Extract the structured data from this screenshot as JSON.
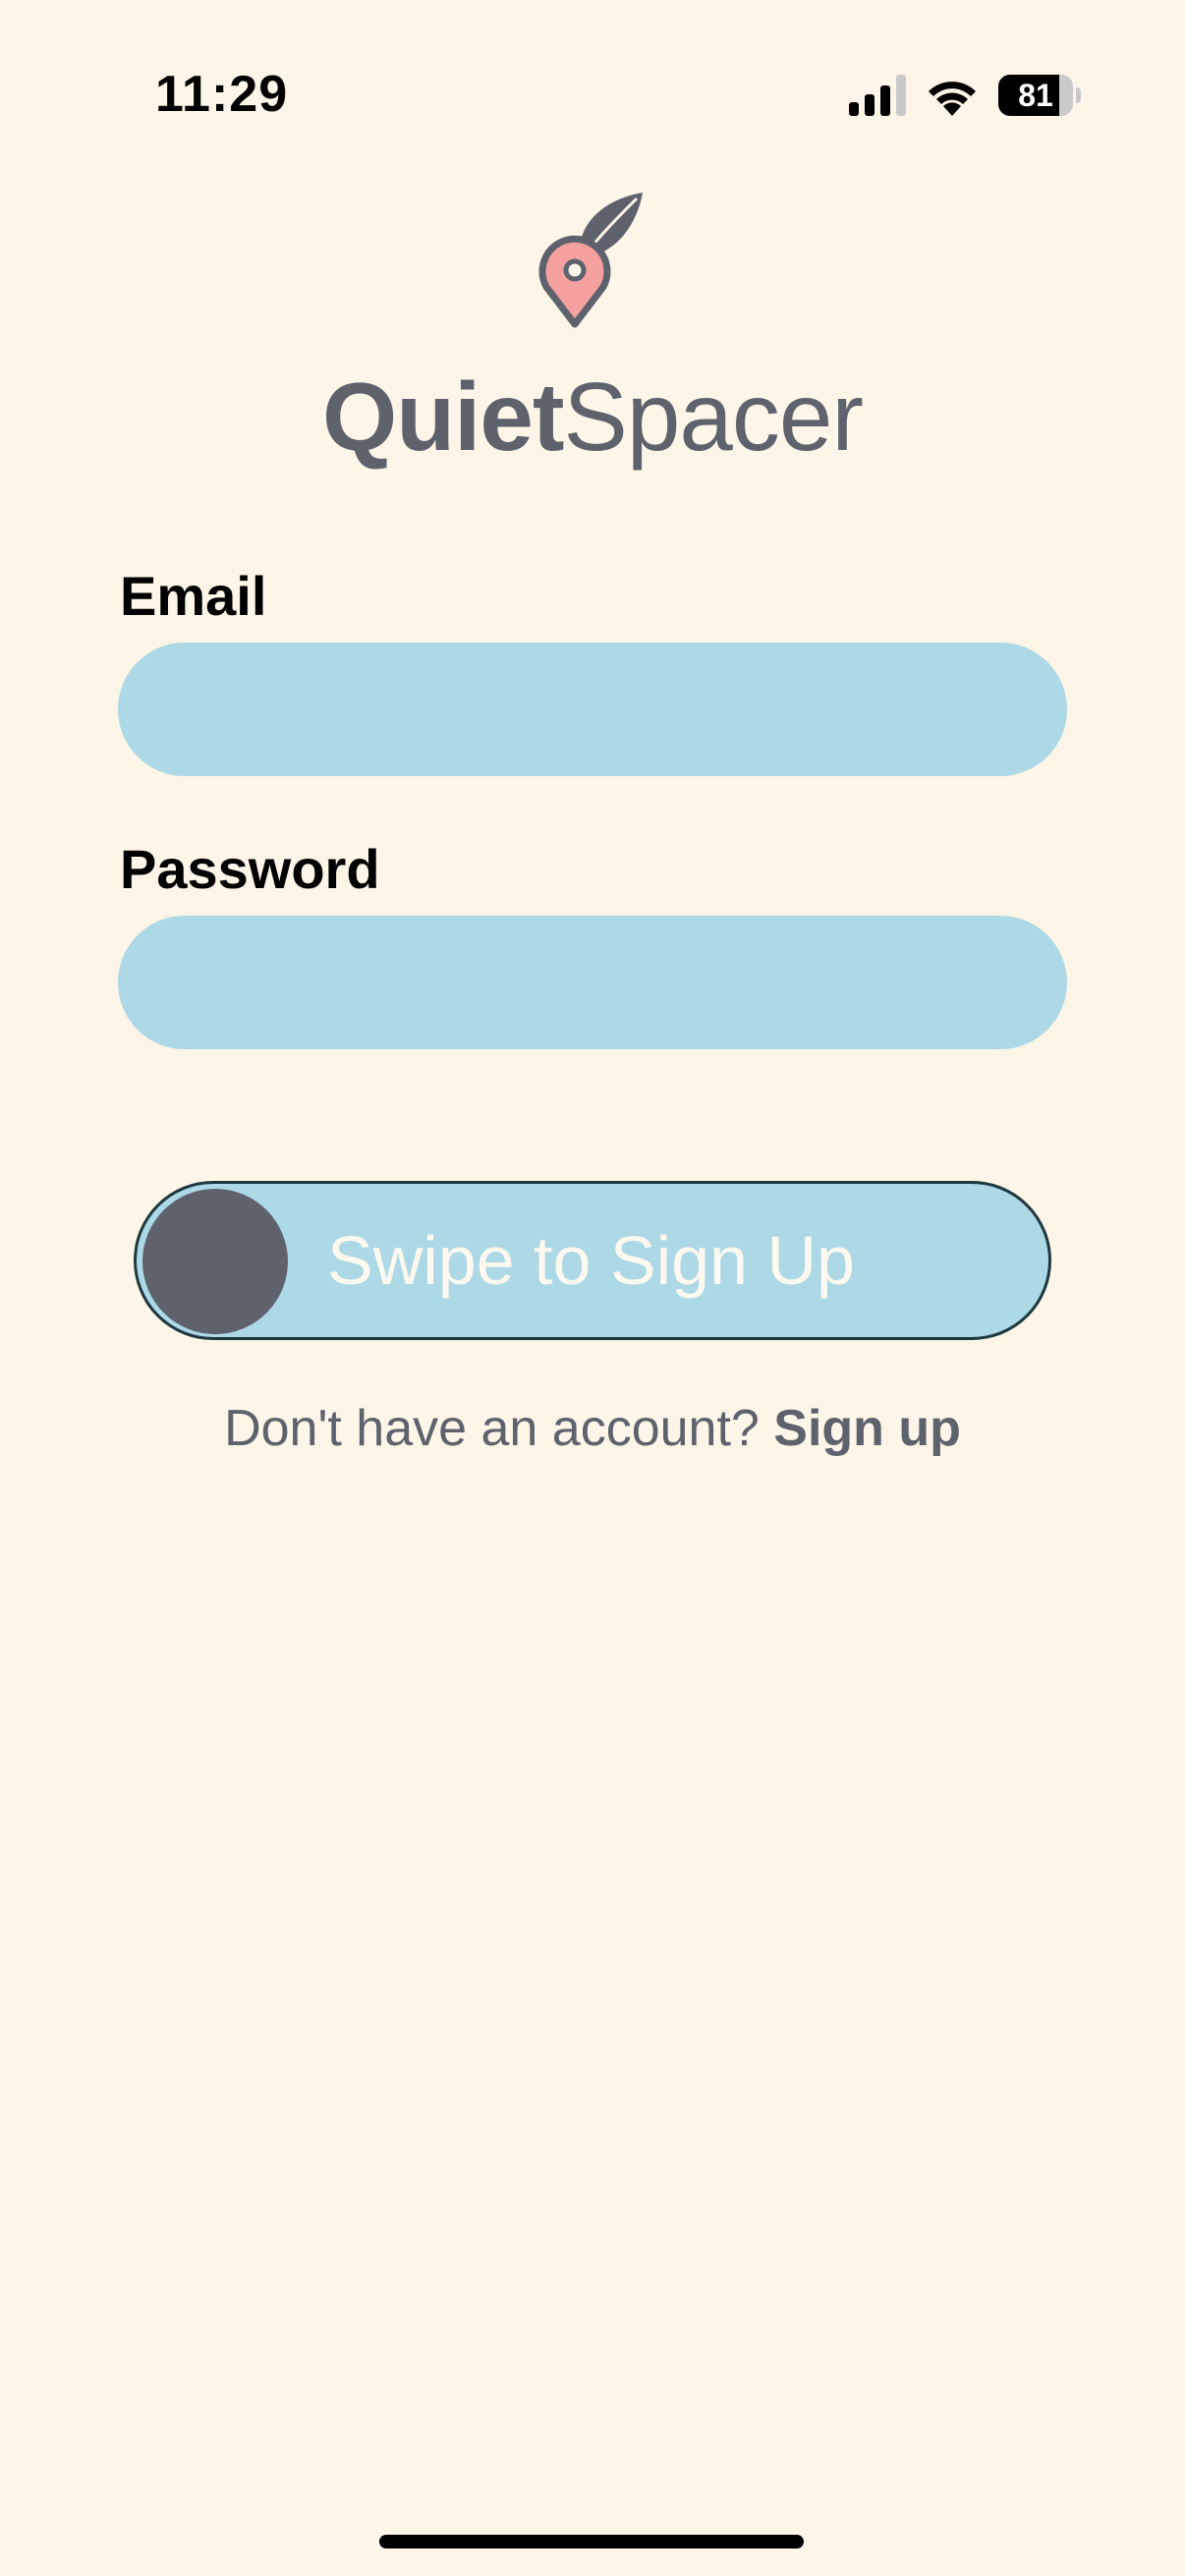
{
  "status_bar": {
    "time": "11:29",
    "battery_level": "81",
    "battery_percent": 81
  },
  "brand": {
    "name_bold": "Quiet",
    "name_light": "Spacer",
    "logo_icon": "leaf-location-pin-icon",
    "text_color": "#5e626d",
    "pin_color": "#f4a1a0"
  },
  "form": {
    "email_label": "Email",
    "email_value": "",
    "password_label": "Password",
    "password_value": "",
    "input_color": "#add8e6"
  },
  "swipe": {
    "label": "Swipe to Sign Up",
    "knob_color": "#5e626d"
  },
  "signup": {
    "prompt": "Don't have an account?",
    "link": "Sign up"
  },
  "colors": {
    "background": "#fdf5e7"
  }
}
